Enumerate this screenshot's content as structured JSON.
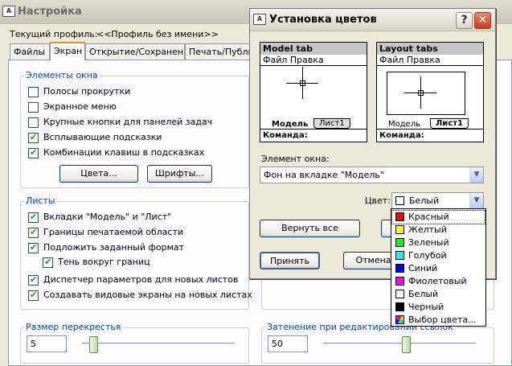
{
  "main_window": {
    "title": "Настройка",
    "profile_label": "Текущий профиль:",
    "profile_value": "<<Профиль без имени>>",
    "tabs": [
      "Файлы",
      "Экран",
      "Открытие/Сохранение",
      "Печать/Публи"
    ],
    "window_elements": {
      "title": "Элементы окна",
      "checkboxes": [
        {
          "label": "Полосы прокрутки",
          "checked": false
        },
        {
          "label": "Экранное меню",
          "checked": false
        },
        {
          "label": "Крупные кнопки для панелей задач",
          "checked": false
        },
        {
          "label": "Всплывающие подсказки",
          "checked": true
        },
        {
          "label": "Комбинации клавиш в подсказках",
          "checked": true
        }
      ],
      "colors_button": "Цвета...",
      "fonts_button": "Шрифты..."
    },
    "sheets": {
      "title": "Листы",
      "checkboxes": [
        {
          "label": "Вкладки \"Модель\" и \"Лист\"",
          "checked": true
        },
        {
          "label": "Границы печатаемой области",
          "checked": true
        },
        {
          "label": "Подложить заданный формат",
          "checked": true
        },
        {
          "label": "Тень вокруг границ",
          "checked": true
        },
        {
          "label": "Диспетчер параметров для новых листов",
          "checked": true
        },
        {
          "label": "Создавать видовые экраны на новых листах",
          "checked": true
        }
      ]
    },
    "crosshair": {
      "title": "Размер перекрестья",
      "value": "5",
      "level_fraction": 0.05
    },
    "fade": {
      "title": "Затенение при редактировании ссылок",
      "value": "50",
      "level_fraction": 0.55
    }
  },
  "dialog": {
    "title": "Установка цветов",
    "help_label": "?",
    "close_label": "✕",
    "model_preview": {
      "header": "Model tab",
      "menu": "Файл  Правка",
      "tab1": "Модель",
      "tab2": "Лист1",
      "command": "Команда:"
    },
    "layout_preview": {
      "header": "Layout tabs",
      "menu": "Файл  Правка",
      "tab1": "Модель",
      "tab2": "Лист1",
      "command": "Команда:"
    },
    "element_label": "Элемент окна:",
    "element_value": "Фон на вкладке \"Модель\"",
    "color_label": "Цвет:",
    "color_value": "Белый",
    "restore_button": "Вернуть все",
    "ok_button": "Принять",
    "cancel_button": "Отмена",
    "color_options": [
      {
        "label": "Красный",
        "color": "#ff0000"
      },
      {
        "label": "Желтый",
        "color": "#ffff00"
      },
      {
        "label": "Зеленый",
        "color": "#00ff00"
      },
      {
        "label": "Голубой",
        "color": "#00ffff"
      },
      {
        "label": "Синий",
        "color": "#0000ff"
      },
      {
        "label": "Фиолетовый",
        "color": "#ff00ff"
      },
      {
        "label": "Белый",
        "color": "#ffffff"
      },
      {
        "label": "Черный",
        "color": "#000000"
      },
      {
        "label": "Выбор цвета...",
        "color": "multicolor"
      }
    ]
  }
}
